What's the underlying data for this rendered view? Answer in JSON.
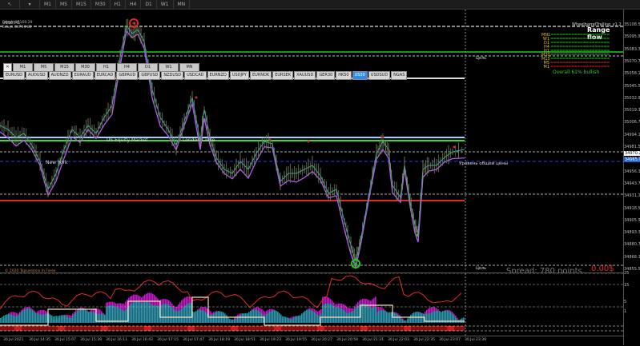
{
  "toolbar": {
    "timeframes": [
      "M1",
      "M5",
      "M15",
      "M30",
      "H1",
      "H4",
      "D1",
      "W1",
      "MN"
    ]
  },
  "chart": {
    "symbol": "US30,M1",
    "info_line1": "5dayH 35169.29",
    "info_line2": "5dayL 34704.85",
    "tf_buttons": [
      "M1",
      "M5",
      "M15",
      "M30",
      "H1",
      "H4",
      "D1",
      "W1",
      "MN"
    ],
    "symbols": [
      "EURUSD",
      "AUDUSD",
      "AUDNZD",
      "EURAUD",
      "EURCAD",
      "GBPAUD",
      "GBPUSD",
      "NZDUSD",
      "USDCAD",
      "EURNZD",
      "USDJPY",
      "EURNOK",
      "EURSEK",
      "XAUUSD",
      "GER30",
      "HK50",
      "US30",
      "USDSUD",
      "NGAS"
    ],
    "active_symbol": "US30",
    "session_labels": {
      "us_equity": "US Equity Market",
      "london_close": "London Close",
      "new_york": "New York"
    },
    "level_label": "Уровень общей цены",
    "target_top": "Цель",
    "target_bottom": "Цель",
    "copyright": "© 2020 TopLessons In Forex",
    "spread": "Spread: 780 points.",
    "dollars": "0.00$"
  },
  "panel": {
    "title": "WheelbarrelTrailing_v1.2",
    "heading": "Range flow",
    "rows": [
      {
        "tf": "MN1",
        "color": "#e8c21a",
        "dir": "up"
      },
      {
        "tf": "W1",
        "color": "#e8c21a",
        "dir": "up"
      },
      {
        "tf": "D1",
        "color": "#e8c21a",
        "dir": "up"
      },
      {
        "tf": "H4",
        "color": "#e8c21a",
        "dir": "up"
      },
      {
        "tf": "H1",
        "color": "#e8c21a",
        "dir": "up"
      },
      {
        "tf": "M30",
        "color": "#e8c21a",
        "dir": "up"
      },
      {
        "tf": "M15",
        "color": "#e8c21a",
        "dir": "up"
      },
      {
        "tf": "M5",
        "color": "#e8c21a",
        "dir": "down"
      },
      {
        "tf": "M1",
        "color": "#e8c21a",
        "dir": "down"
      }
    ],
    "overall": "Overall 61% bullish"
  },
  "yaxis": {
    "ticks": [
      "35108.50",
      "35095.90",
      "35083.30",
      "35070.70",
      "35058.10",
      "35045.50",
      "35032.90",
      "35019.30",
      "35006.70",
      "34994.10",
      "34981.50",
      "34968.90",
      "34956.30",
      "34943.70",
      "34931.10",
      "34918.50",
      "34905.90",
      "34893.30",
      "34880.70",
      "34868.10",
      "34855.50"
    ],
    "current_price": "34970.28",
    "blue_price": "34965.00",
    "sub_ticks": [
      "25",
      "15",
      "5",
      "1"
    ]
  },
  "xaxis": {
    "ticks": [
      "30 Jul 2021",
      "30 Jul 14:35",
      "30 Jul 15:07",
      "30 Jul 15:39",
      "30 Jul 16:11",
      "30 Jul 16:43",
      "30 Jul 17:15",
      "30 Jul 17:47",
      "30 Jul 18:19",
      "30 Jul 18:51",
      "30 Jul 19:23",
      "30 Jul 19:55",
      "30 Jul 20:27",
      "30 Jul 20:59",
      "30 Jul 21:31",
      "30 Jul 22:03",
      "30 Jul 22:35",
      "30 Jul 23:07",
      "30 Jul 23:39"
    ]
  },
  "colors": {
    "up": "#1ecb1e",
    "down": "#e02626",
    "price_line": "#3fa9a9",
    "purple_line": "#b45cf0",
    "magenta_hist": "#c81bc8",
    "teal_hist": "#1aa8a8",
    "sub_red": "#e02b2b",
    "sub_cream": "#f2dcc0"
  }
}
